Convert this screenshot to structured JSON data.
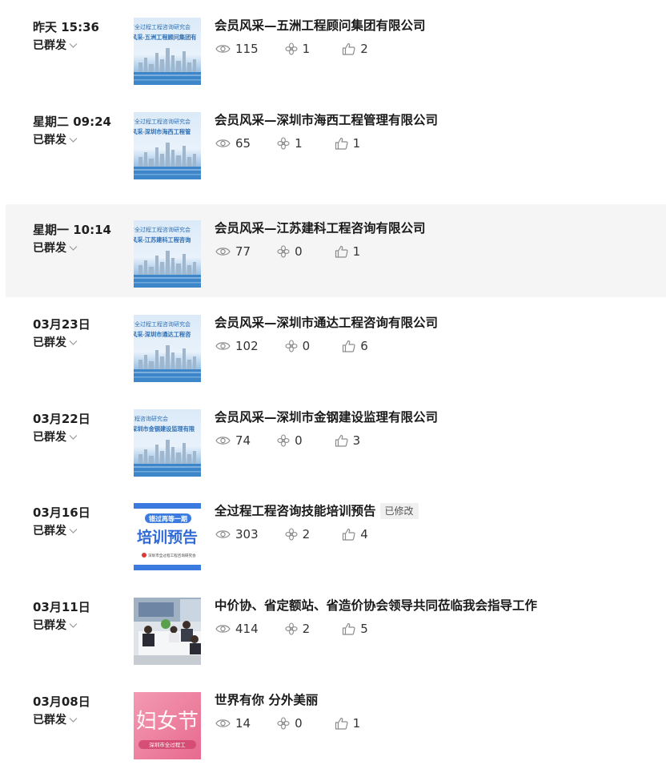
{
  "items": [
    {
      "date": "昨天 15:36",
      "status": "已群发",
      "title": "会员风采—五洲工程顾问集团有限公司",
      "tag": "",
      "views": "115",
      "shares": "1",
      "likes": "2",
      "thumb": {
        "type": "city",
        "line1": "市全过程工程咨询研究会",
        "line2": "风采-五洲工程顾问集团有"
      }
    },
    {
      "date": "星期二 09:24",
      "status": "已群发",
      "title": "会员风采—深圳市海西工程管理有限公司",
      "tag": "",
      "views": "65",
      "shares": "1",
      "likes": "1",
      "thumb": {
        "type": "city",
        "line1": "市全过程工程咨询研究会",
        "line2": "风采-深圳市海西工程管"
      }
    },
    {
      "date": "星期一 10:14",
      "status": "已群发",
      "title": "会员风采—江苏建科工程咨询有限公司",
      "tag": "",
      "views": "77",
      "shares": "0",
      "likes": "1",
      "thumb": {
        "type": "city",
        "line1": "市全过程工程咨询研究会",
        "line2": "风采-江苏建科工程咨询"
      }
    },
    {
      "date": "03月23日",
      "status": "已群发",
      "title": "会员风采—深圳市通达工程咨询有限公司",
      "tag": "",
      "views": "102",
      "shares": "0",
      "likes": "6",
      "thumb": {
        "type": "city",
        "line1": "市全过程工程咨询研究会",
        "line2": "风采-深圳市通达工程咨"
      }
    },
    {
      "date": "03月22日",
      "status": "已群发",
      "title": "会员风采—深圳市金钢建设监理有限公司",
      "tag": "",
      "views": "74",
      "shares": "0",
      "likes": "3",
      "thumb": {
        "type": "city",
        "line1": "工程咨询研究会",
        "line2": "深圳市金钢建设监理有限"
      }
    },
    {
      "date": "03月16日",
      "status": "已群发",
      "title": "全过程工程咨询技能培训预告",
      "tag": "已修改",
      "views": "303",
      "shares": "2",
      "likes": "4",
      "thumb": {
        "type": "training",
        "line1": "错过再等一期",
        "line2": "培训预告",
        "line3": "深圳市全过程工程咨询研究会"
      }
    },
    {
      "date": "03月11日",
      "status": "已群发",
      "title": "中价协、省定额站、省造价协会领导共同莅临我会指导工作",
      "tag": "",
      "views": "414",
      "shares": "2",
      "likes": "5",
      "thumb": {
        "type": "photo"
      }
    },
    {
      "date": "03月08日",
      "status": "已群发",
      "title": "世界有你 分外美丽",
      "tag": "",
      "views": "14",
      "shares": "0",
      "likes": "1",
      "thumb": {
        "type": "womens",
        "line1": "妇女节",
        "line2": "深圳市全过程工"
      }
    }
  ]
}
